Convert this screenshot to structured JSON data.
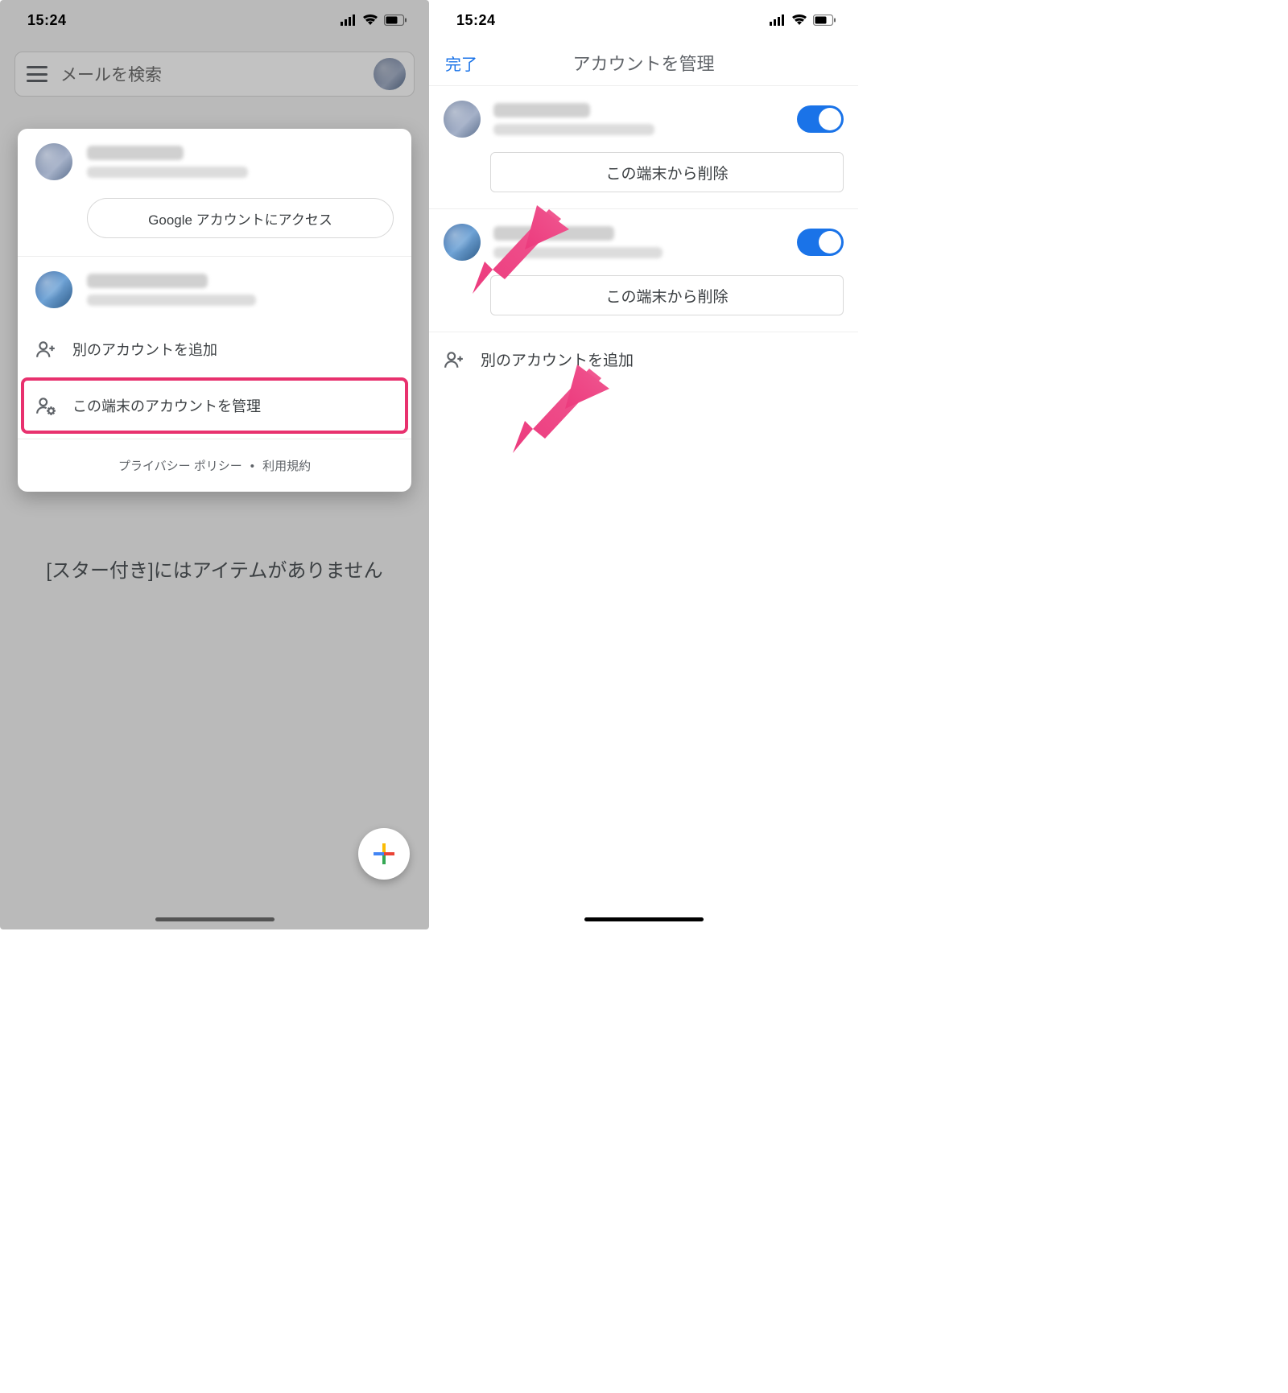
{
  "statusbar": {
    "time": "15:24"
  },
  "left": {
    "search_placeholder": "メールを検索",
    "access_google": "Google アカウントにアクセス",
    "add_account": "別のアカウントを追加",
    "manage_accounts": "この端末のアカウントを管理",
    "privacy": "プライバシー ポリシー",
    "terms": "利用規約",
    "empty_state": "[スター付き]にはアイテムがありません"
  },
  "right": {
    "done": "完了",
    "title": "アカウントを管理",
    "delete_from_device": "この端末から削除",
    "add_account": "別のアカウントを追加"
  }
}
